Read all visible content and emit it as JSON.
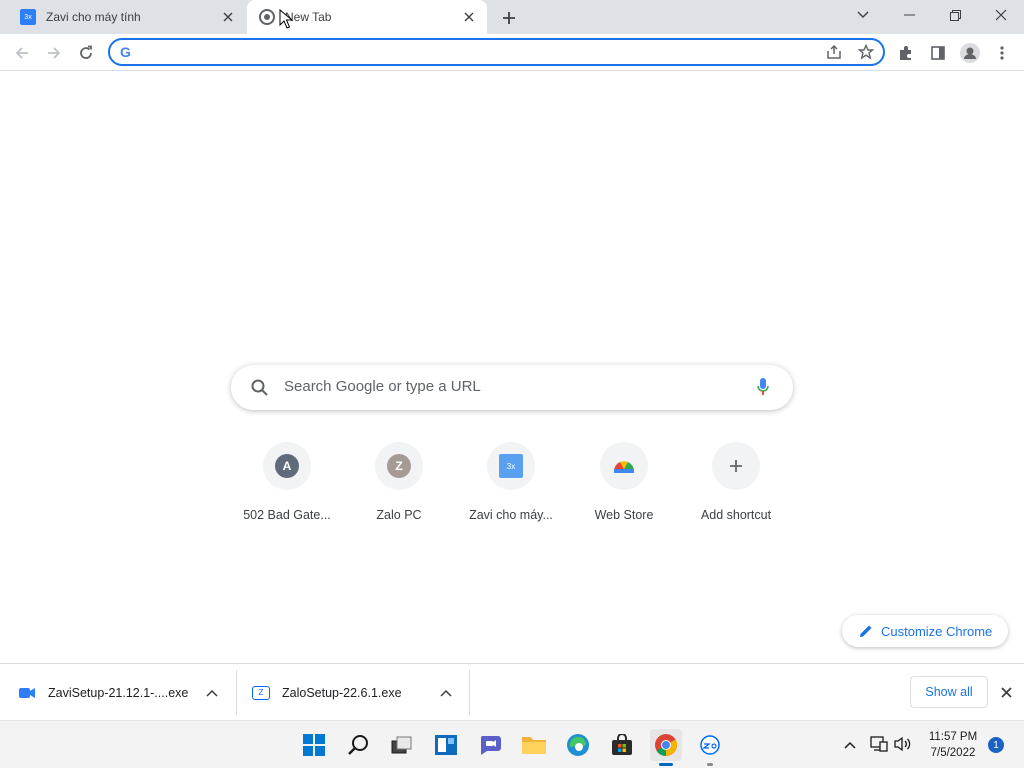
{
  "tabs": [
    {
      "title": "Zavi cho máy tính",
      "favicon": "zavi-icon",
      "active": false
    },
    {
      "title": "New Tab",
      "favicon": "chrome-icon",
      "active": true
    }
  ],
  "omnibox": {
    "value": "",
    "placeholder": ""
  },
  "ntp": {
    "search_placeholder": "Search Google or type a URL",
    "shortcuts": [
      {
        "label": "502 Bad Gate...",
        "letter": "A",
        "color": "#5f6b7a"
      },
      {
        "label": "Zalo PC",
        "letter": "Z",
        "color": "#a69a94"
      },
      {
        "label": "Zavi cho máy...",
        "letter": "",
        "color": "#5aa0f0"
      },
      {
        "label": "Web Store",
        "letter": "",
        "color": ""
      },
      {
        "label": "Add shortcut",
        "letter": "",
        "color": ""
      }
    ],
    "customize_label": "Customize Chrome"
  },
  "downloads": {
    "items": [
      {
        "filename": "ZaviSetup-21.12.1-....exe",
        "icon": "zavi-icon"
      },
      {
        "filename": "ZaloSetup-22.6.1.exe",
        "icon": "zalo-icon"
      }
    ],
    "show_all_label": "Show all"
  },
  "taskbar": {
    "time": "11:57 PM",
    "date": "7/5/2022",
    "notification_count": "1"
  },
  "colors": {
    "accent": "#1a73e8",
    "tabstrip": "#dee1e6",
    "taskbar": "#f3f3f3"
  }
}
